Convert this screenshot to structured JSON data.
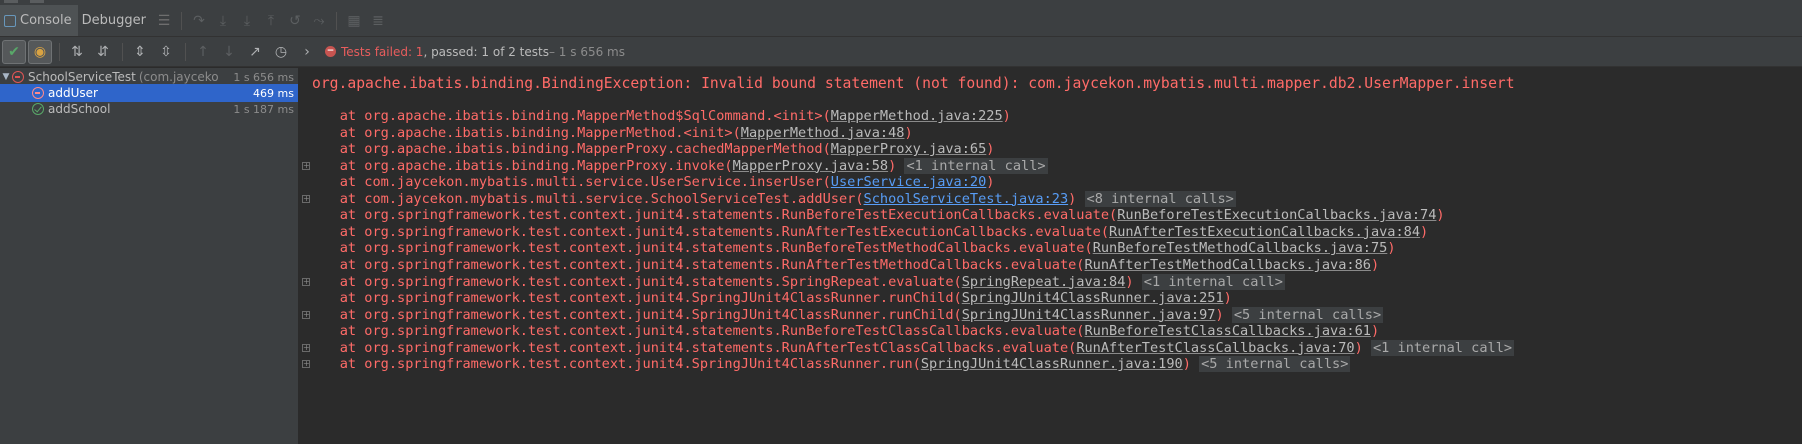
{
  "header": {
    "tabs": [
      {
        "label": "Console",
        "active": true
      },
      {
        "label": "Debugger",
        "active": false
      }
    ]
  },
  "toolbar": {
    "status_failed": "Tests failed: 1",
    "status_rest": ", passed: 1 of 2 tests",
    "status_time": " – 1 s 656 ms"
  },
  "tree": {
    "items": [
      {
        "name": "SchoolServiceTest",
        "pkg": "(com.jayceko",
        "duration": "1 s 656 ms",
        "status": "fail",
        "selected": false
      },
      {
        "name": "addUser",
        "pkg": "",
        "duration": "469 ms",
        "status": "fail",
        "selected": true
      },
      {
        "name": "addSchool",
        "pkg": "",
        "duration": "1 s 187 ms",
        "status": "pass",
        "selected": false
      }
    ]
  },
  "console": {
    "exception": "org.apache.ibatis.binding.BindingException: Invalid bound statement (not found): com.jaycekon.mybatis.multi.mapper.db2.UserMapper.insert",
    "frames": [
      {
        "text": "at org.apache.ibatis.binding.MapperMethod$SqlCommand.<init>(",
        "link": "MapperMethod.java:225",
        "suffix": ")",
        "internal": "",
        "blue": false,
        "fold": false
      },
      {
        "text": "at org.apache.ibatis.binding.MapperMethod.<init>(",
        "link": "MapperMethod.java:48",
        "suffix": ")",
        "internal": "",
        "blue": false,
        "fold": false
      },
      {
        "text": "at org.apache.ibatis.binding.MapperProxy.cachedMapperMethod(",
        "link": "MapperProxy.java:65",
        "suffix": ")",
        "internal": "",
        "blue": false,
        "fold": false
      },
      {
        "text": "at org.apache.ibatis.binding.MapperProxy.invoke(",
        "link": "MapperProxy.java:58",
        "suffix": ")",
        "internal": "<1 internal call>",
        "blue": false,
        "fold": true
      },
      {
        "text": "at com.jaycekon.mybatis.multi.service.UserService.inserUser(",
        "link": "UserService.java:20",
        "suffix": ")",
        "internal": "",
        "blue": true,
        "fold": false
      },
      {
        "text": "at com.jaycekon.mybatis.multi.service.SchoolServiceTest.addUser(",
        "link": "SchoolServiceTest.java:23",
        "suffix": ")",
        "internal": "<8 internal calls>",
        "blue": true,
        "fold": true
      },
      {
        "text": "at org.springframework.test.context.junit4.statements.RunBeforeTestExecutionCallbacks.evaluate(",
        "link": "RunBeforeTestExecutionCallbacks.java:74",
        "suffix": ")",
        "internal": "",
        "blue": false,
        "fold": false
      },
      {
        "text": "at org.springframework.test.context.junit4.statements.RunAfterTestExecutionCallbacks.evaluate(",
        "link": "RunAfterTestExecutionCallbacks.java:84",
        "suffix": ")",
        "internal": "",
        "blue": false,
        "fold": false
      },
      {
        "text": "at org.springframework.test.context.junit4.statements.RunBeforeTestMethodCallbacks.evaluate(",
        "link": "RunBeforeTestMethodCallbacks.java:75",
        "suffix": ")",
        "internal": "",
        "blue": false,
        "fold": false
      },
      {
        "text": "at org.springframework.test.context.junit4.statements.RunAfterTestMethodCallbacks.evaluate(",
        "link": "RunAfterTestMethodCallbacks.java:86",
        "suffix": ")",
        "internal": "",
        "blue": false,
        "fold": false
      },
      {
        "text": "at org.springframework.test.context.junit4.statements.SpringRepeat.evaluate(",
        "link": "SpringRepeat.java:84",
        "suffix": ")",
        "internal": "<1 internal call>",
        "blue": false,
        "fold": true
      },
      {
        "text": "at org.springframework.test.context.junit4.SpringJUnit4ClassRunner.runChild(",
        "link": "SpringJUnit4ClassRunner.java:251",
        "suffix": ")",
        "internal": "",
        "blue": false,
        "fold": false
      },
      {
        "text": "at org.springframework.test.context.junit4.SpringJUnit4ClassRunner.runChild(",
        "link": "SpringJUnit4ClassRunner.java:97",
        "suffix": ")",
        "internal": "<5 internal calls>",
        "blue": false,
        "fold": true
      },
      {
        "text": "at org.springframework.test.context.junit4.statements.RunBeforeTestClassCallbacks.evaluate(",
        "link": "RunBeforeTestClassCallbacks.java:61",
        "suffix": ")",
        "internal": "",
        "blue": false,
        "fold": false
      },
      {
        "text": "at org.springframework.test.context.junit4.statements.RunAfterTestClassCallbacks.evaluate(",
        "link": "RunAfterTestClassCallbacks.java:70",
        "suffix": ")",
        "internal": "<1 internal call>",
        "blue": false,
        "fold": true
      },
      {
        "text": "at org.springframework.test.context.junit4.SpringJUnit4ClassRunner.run(",
        "link": "SpringJUnit4ClassRunner.java:190",
        "suffix": ")",
        "internal": "<5 internal calls>",
        "blue": false,
        "fold": true
      }
    ]
  }
}
